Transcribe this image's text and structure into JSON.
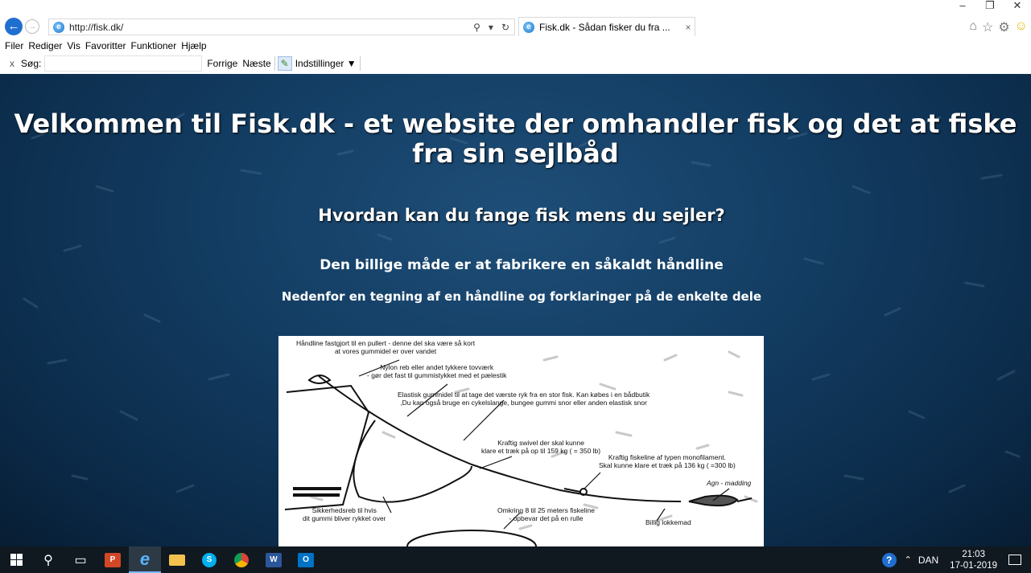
{
  "window": {
    "minimize": "–",
    "restore": "❐",
    "close": "✕"
  },
  "browser": {
    "url": "http://fisk.dk/",
    "tab_title": "Fisk.dk - Sådan fisker du fra ...",
    "tab_close": "×",
    "search_icon": "⚲",
    "dropdown_icon": "▾",
    "refresh_icon": "↻",
    "back_icon": "←",
    "forward_icon": "→"
  },
  "menu": [
    "Filer",
    "Rediger",
    "Vis",
    "Favoritter",
    "Funktioner",
    "Hjælp"
  ],
  "findbar": {
    "close": "x",
    "label": "Søg:",
    "value": "",
    "prev": "Forrige",
    "next": "Næste",
    "options": "Indstillinger ▼"
  },
  "page": {
    "title": "Velkommen til Fisk.dk - et website der omhandler fisk og det at fiske fra sin sejlbåd",
    "subtitle": "Hvordan kan du fange fisk mens du sejler?",
    "line1": "Den billige måde er at fabrikere en såkaldt håndline",
    "line2": "Nedenfor en tegning af en håndline og forklaringer på de enkelte dele"
  },
  "drawing": {
    "l1": "Håndline fastgjort til en pullert - denne del ska være så kort",
    "l1b": "at vores gummidel er over vandet",
    "l2": "Nylon reb eller andet tykkere tovværk",
    "l2b": "- gør det fast til gummistykket med et pælestik",
    "l3": "Elastisk gummidel til at tage det værste ryk fra en stor fisk. Kan købes i en bådbutik",
    "l3b": ",Du kan også bruge en cykelslange, bungee gummi  snor eller anden elastisk snor",
    "l4": "Kraftig swivel der skal kunne",
    "l4b": "klare et træk på op til 159 kg ( = 350 lb)",
    "l5": "Kraftig fiskeline af typen monofilament.",
    "l5b": "Skal kunne klare et træk på 136 kg ( =300 lb)",
    "l6": "Agn - madding",
    "l7": "Sikkerhedsreb til hvis",
    "l7b": "dit gummi bliver rykket over",
    "l8": "Omkring 8 til 25 meters fiskeline",
    "l8b": "- opbevar det på en rulle",
    "l9": "Billig lokkemad"
  },
  "taskbar": {
    "language": "DAN",
    "time": "21:03",
    "date": "17-01-2019",
    "powerpoint": "P",
    "word": "W",
    "outlook": "O",
    "skype": "S"
  }
}
